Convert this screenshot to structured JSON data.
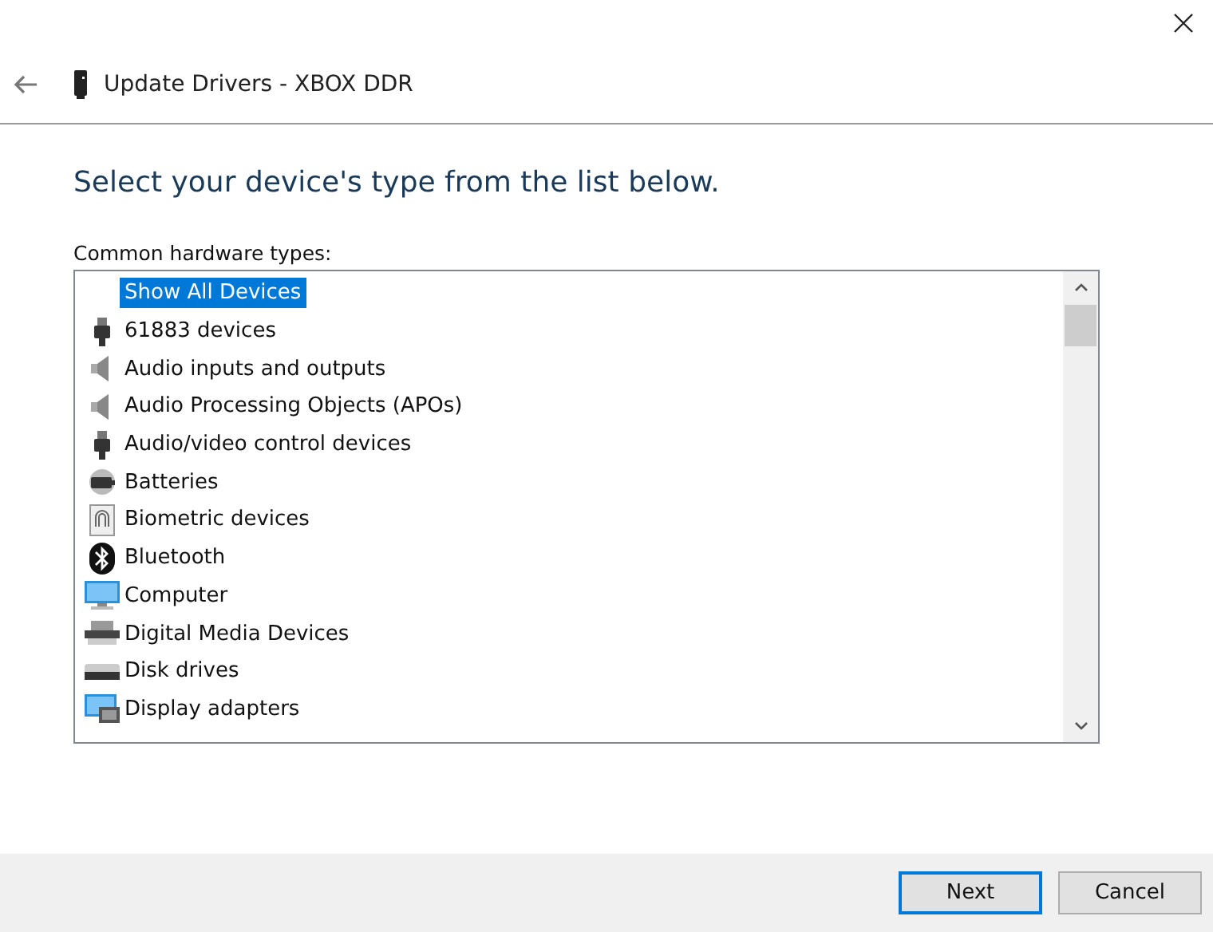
{
  "window": {
    "title": "Update Drivers - XBOX DDR"
  },
  "heading": "Select your device's type from the list below.",
  "list_label": "Common hardware types:",
  "items": [
    {
      "label": "Show All Devices",
      "kind": "none",
      "selected": true
    },
    {
      "label": "61883 devices",
      "kind": "plug",
      "selected": false
    },
    {
      "label": "Audio inputs and outputs",
      "kind": "speaker",
      "selected": false
    },
    {
      "label": "Audio Processing Objects (APOs)",
      "kind": "speaker",
      "selected": false
    },
    {
      "label": "Audio/video control devices",
      "kind": "plug",
      "selected": false
    },
    {
      "label": "Batteries",
      "kind": "battery",
      "selected": false
    },
    {
      "label": "Biometric devices",
      "kind": "fingerprint",
      "selected": false
    },
    {
      "label": "Bluetooth",
      "kind": "bluetooth",
      "selected": false
    },
    {
      "label": "Computer",
      "kind": "monitor",
      "selected": false
    },
    {
      "label": "Digital Media Devices",
      "kind": "media",
      "selected": false
    },
    {
      "label": "Disk drives",
      "kind": "disk",
      "selected": false
    },
    {
      "label": "Display adapters",
      "kind": "display",
      "selected": false
    }
  ],
  "buttons": [
    {
      "label": "Next",
      "selected": true
    },
    {
      "label": "Cancel",
      "selected": false
    }
  ]
}
